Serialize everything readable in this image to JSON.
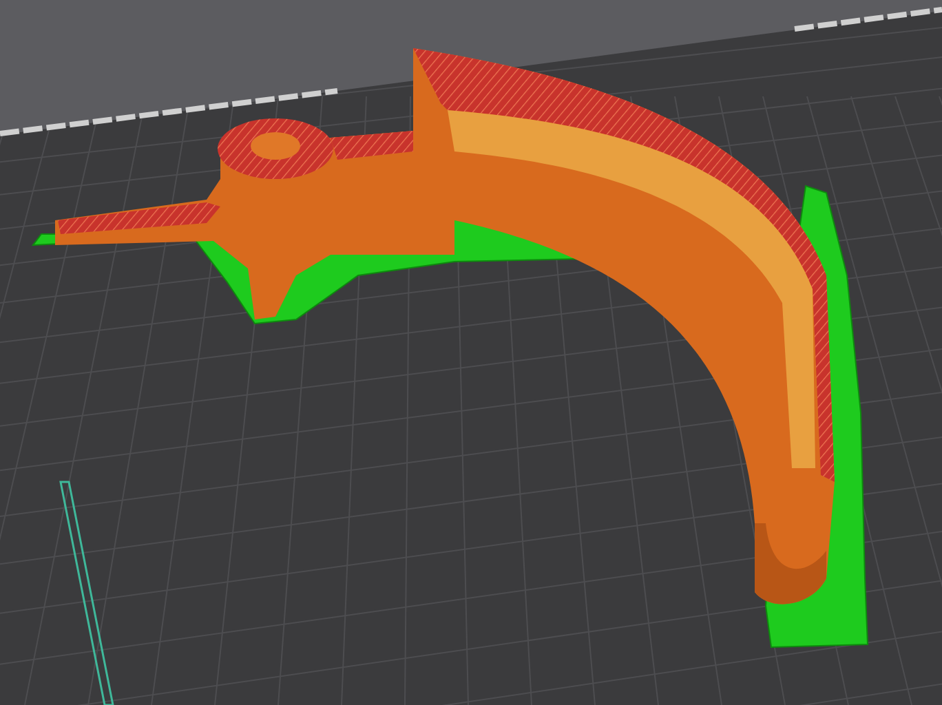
{
  "scene": {
    "kind": "print-preview"
  }
}
